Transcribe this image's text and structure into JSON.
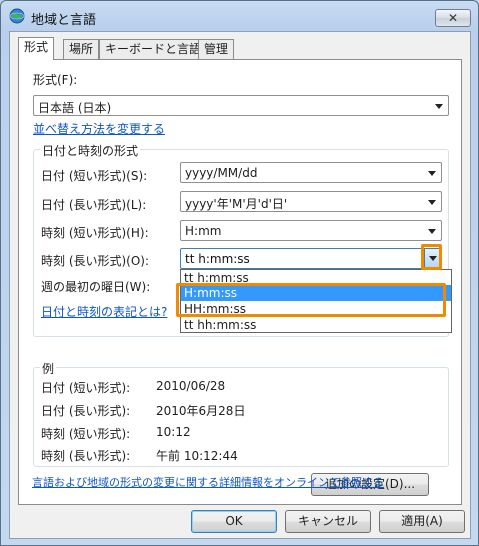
{
  "window": {
    "title": "地域と言語",
    "close_glyph": "✕"
  },
  "tabs": [
    "形式",
    "場所",
    "キーボードと言語",
    "管理"
  ],
  "format": {
    "label": "形式(F):",
    "value": "日本語 (日本)",
    "sort_link": "並べ替え方法を変更する"
  },
  "datetime_group": {
    "title": "日付と時刻の形式",
    "rows": [
      {
        "label": "日付 (短い形式)(S):",
        "value": "yyyy/MM/dd"
      },
      {
        "label": "日付 (長い形式)(L):",
        "value": "yyyy'年'M'月'd'日'"
      },
      {
        "label": "時刻 (短い形式)(H):",
        "value": "H:mm"
      },
      {
        "label": "時刻 (長い形式)(O):",
        "value": "tt h:mm:ss"
      },
      {
        "label": "週の最初の曜日(W):",
        "value": ""
      }
    ],
    "dropdown_options": [
      "tt h:mm:ss",
      "H:mm:ss",
      "HH:mm:ss",
      "tt hh:mm:ss"
    ],
    "selected_option": "H:mm:ss",
    "notation_link": "日付と時刻の表記とは?"
  },
  "example": {
    "title": "例",
    "rows": [
      {
        "label": "日付 (短い形式):",
        "value": "2010/06/28"
      },
      {
        "label": "日付 (長い形式):",
        "value": "2010年6月28日"
      },
      {
        "label": "時刻 (短い形式):",
        "value": "10:12"
      },
      {
        "label": "時刻 (長い形式):",
        "value": "午前 10:12:44"
      }
    ]
  },
  "additional_button": "追加の設定(D)...",
  "online_link": "言語および地域の形式の変更に関する詳細情報をオンラインで参照する",
  "buttons": {
    "ok": "OK",
    "cancel": "キャンセル",
    "apply": "適用(A)"
  },
  "colors": {
    "highlight": "#f08a00",
    "selection": "#3399ff",
    "link": "#0f55c8"
  }
}
